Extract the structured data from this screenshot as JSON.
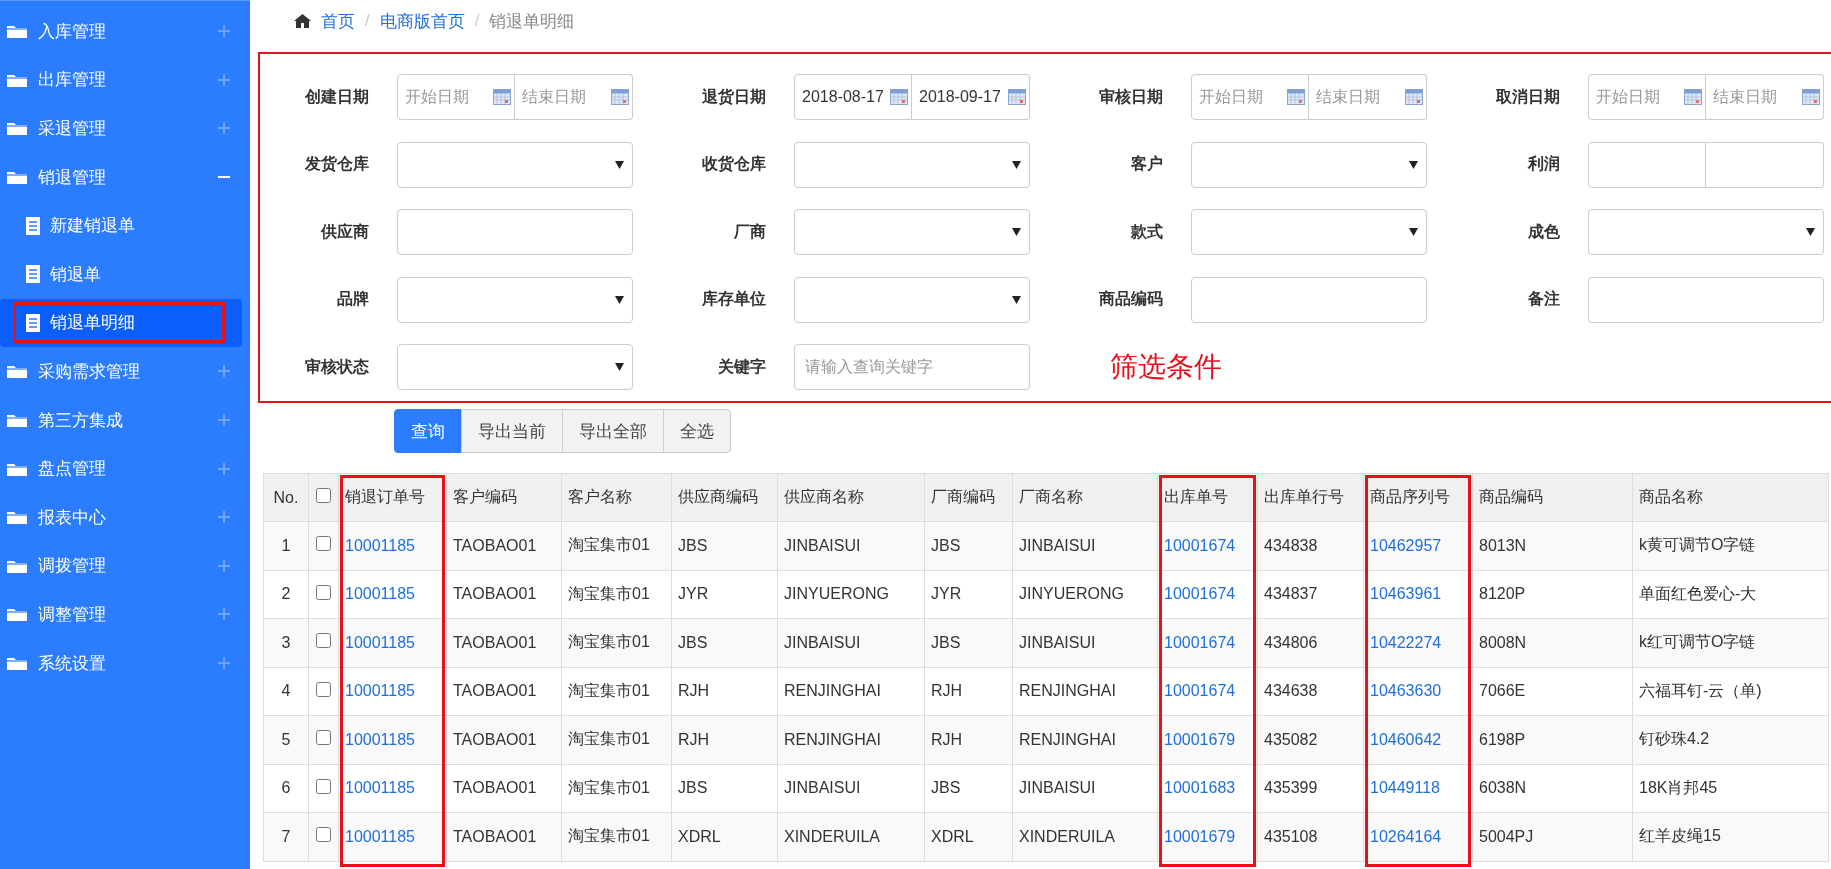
{
  "sidebar": {
    "items": [
      {
        "label": "入库管理",
        "expanded": false
      },
      {
        "label": "出库管理",
        "expanded": false
      },
      {
        "label": "采退管理",
        "expanded": false
      },
      {
        "label": "销退管理",
        "expanded": true,
        "children": [
          {
            "label": "新建销退单",
            "selected": false,
            "highlighted": false
          },
          {
            "label": "销退单",
            "selected": false,
            "highlighted": false
          },
          {
            "label": "销退单明细",
            "selected": true,
            "highlighted": true
          }
        ]
      },
      {
        "label": "采购需求管理",
        "expanded": false
      },
      {
        "label": "第三方集成",
        "expanded": false
      },
      {
        "label": "盘点管理",
        "expanded": false
      },
      {
        "label": "报表中心",
        "expanded": false
      },
      {
        "label": "调拨管理",
        "expanded": false
      },
      {
        "label": "调整管理",
        "expanded": false
      },
      {
        "label": "系统设置",
        "expanded": false
      }
    ]
  },
  "breadcrumb": [
    {
      "kind": "link",
      "label": "首页"
    },
    {
      "kind": "separator",
      "label": "/"
    },
    {
      "kind": "link",
      "label": "电商版首页"
    },
    {
      "kind": "separator",
      "label": "/"
    },
    {
      "kind": "current",
      "label": "销退单明细"
    }
  ],
  "filters": [
    {
      "label": "创建日期",
      "kind": "date_range",
      "start": {
        "placeholder": "开始日期"
      },
      "end": {
        "placeholder": "结束日期"
      }
    },
    {
      "label": "退货日期",
      "kind": "date_range",
      "start": {
        "value": "2018-08-17"
      },
      "end": {
        "value": "2018-09-17"
      }
    },
    {
      "label": "审核日期",
      "kind": "date_range",
      "start": {
        "placeholder": "开始日期"
      },
      "end": {
        "placeholder": "结束日期"
      }
    },
    {
      "label": "取消日期",
      "kind": "date_range",
      "start": {
        "placeholder": "开始日期"
      },
      "end": {
        "placeholder": "结束日期"
      }
    },
    {
      "label": "发货仓库",
      "kind": "select"
    },
    {
      "label": "收货仓库",
      "kind": "select"
    },
    {
      "label": "客户",
      "kind": "select"
    },
    {
      "label": "利润",
      "kind": "range"
    },
    {
      "label": "供应商",
      "kind": "text"
    },
    {
      "label": "厂商",
      "kind": "select"
    },
    {
      "label": "款式",
      "kind": "select"
    },
    {
      "label": "成色",
      "kind": "select"
    },
    {
      "label": "品牌",
      "kind": "select"
    },
    {
      "label": "库存单位",
      "kind": "select"
    },
    {
      "label": "商品编码",
      "kind": "text"
    },
    {
      "label": "备注",
      "kind": "text"
    },
    {
      "label": "审核状态",
      "kind": "select"
    },
    {
      "label": "关键字",
      "kind": "text",
      "placeholder": "请输入查询关键字"
    }
  ],
  "annotation": "筛选条件",
  "buttons": [
    {
      "label": "查询",
      "primary": true
    },
    {
      "label": "导出当前",
      "primary": false
    },
    {
      "label": "导出全部",
      "primary": false
    },
    {
      "label": "全选",
      "primary": false
    }
  ],
  "table": {
    "select_all": {
      "checked": false
    },
    "columns": [
      {
        "kind": "number",
        "label": "No.",
        "highlighted": false
      },
      {
        "kind": "link",
        "label": "销退订单号",
        "highlighted": true
      },
      {
        "kind": "text",
        "label": "客户编码",
        "highlighted": false
      },
      {
        "kind": "text",
        "label": "客户名称",
        "highlighted": false
      },
      {
        "kind": "text",
        "label": "供应商编码",
        "highlighted": false
      },
      {
        "kind": "text",
        "label": "供应商名称",
        "highlighted": false
      },
      {
        "kind": "text",
        "label": "厂商编码",
        "highlighted": false
      },
      {
        "kind": "text",
        "label": "厂商名称",
        "highlighted": false
      },
      {
        "kind": "link",
        "label": "出库单号",
        "highlighted": true
      },
      {
        "kind": "text",
        "label": "出库单行号",
        "highlighted": false
      },
      {
        "kind": "link",
        "label": "商品序列号",
        "highlighted": true
      },
      {
        "kind": "text",
        "label": "商品编码",
        "highlighted": false
      },
      {
        "kind": "text",
        "label": "商品名称",
        "highlighted": false
      }
    ],
    "rows": [
      {
        "checked": false,
        "cells": [
          "1",
          "10001185",
          "TAOBAO01",
          "淘宝集市01",
          "JBS",
          "JINBAISUI",
          "JBS",
          "JINBAISUI",
          "10001674",
          "434838",
          "10462957",
          "8013N",
          "k黄可调节O字链"
        ]
      },
      {
        "checked": false,
        "cells": [
          "2",
          "10001185",
          "TAOBAO01",
          "淘宝集市01",
          "JYR",
          "JINYUERONG",
          "JYR",
          "JINYUERONG",
          "10001674",
          "434837",
          "10463961",
          "8120P",
          "单面红色爱心-大"
        ]
      },
      {
        "checked": false,
        "cells": [
          "3",
          "10001185",
          "TAOBAO01",
          "淘宝集市01",
          "JBS",
          "JINBAISUI",
          "JBS",
          "JINBAISUI",
          "10001674",
          "434806",
          "10422274",
          "8008N",
          "k红可调节O字链"
        ]
      },
      {
        "checked": false,
        "cells": [
          "4",
          "10001185",
          "TAOBAO01",
          "淘宝集市01",
          "RJH",
          "RENJINGHAI",
          "RJH",
          "RENJINGHAI",
          "10001674",
          "434638",
          "10463630",
          "7066E",
          "六福耳钉-云（单)"
        ]
      },
      {
        "checked": false,
        "cells": [
          "5",
          "10001185",
          "TAOBAO01",
          "淘宝集市01",
          "RJH",
          "RENJINGHAI",
          "RJH",
          "RENJINGHAI",
          "10001679",
          "435082",
          "10460642",
          "6198P",
          "钉砂珠4.2"
        ]
      },
      {
        "checked": false,
        "cells": [
          "6",
          "10001185",
          "TAOBAO01",
          "淘宝集市01",
          "JBS",
          "JINBAISUI",
          "JBS",
          "JINBAISUI",
          "10001683",
          "435399",
          "10449118",
          "6038N",
          "18K肖邦45"
        ]
      },
      {
        "checked": false,
        "cells": [
          "7",
          "10001185",
          "TAOBAO01",
          "淘宝集市01",
          "XDRL",
          "XINDERUILA",
          "XDRL",
          "XINDERUILA",
          "10001679",
          "435108",
          "10264164",
          "5004PJ",
          "红羊皮绳15"
        ]
      }
    ]
  }
}
